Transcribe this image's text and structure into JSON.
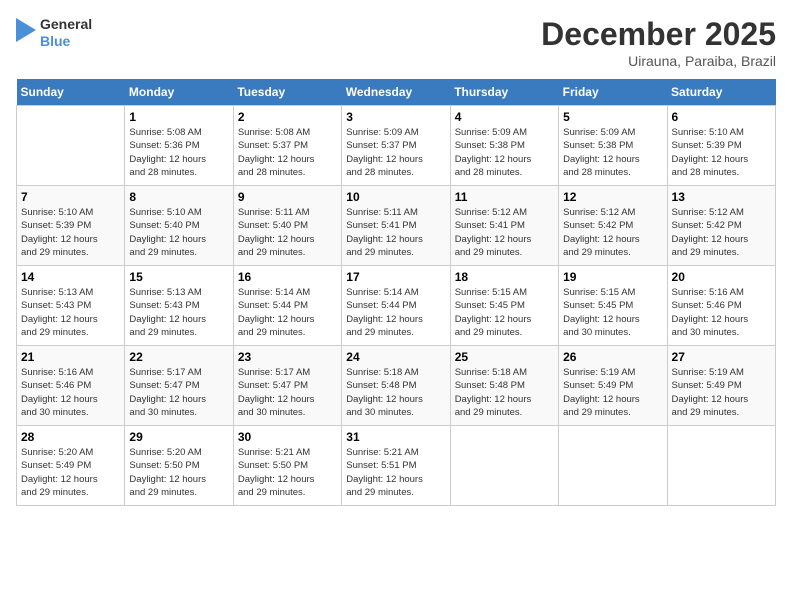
{
  "header": {
    "logo_line1": "General",
    "logo_line2": "Blue",
    "month": "December 2025",
    "location": "Uirauna, Paraiba, Brazil"
  },
  "days_of_week": [
    "Sunday",
    "Monday",
    "Tuesday",
    "Wednesday",
    "Thursday",
    "Friday",
    "Saturday"
  ],
  "weeks": [
    [
      {
        "day": "",
        "info": ""
      },
      {
        "day": "1",
        "info": "Sunrise: 5:08 AM\nSunset: 5:36 PM\nDaylight: 12 hours\nand 28 minutes."
      },
      {
        "day": "2",
        "info": "Sunrise: 5:08 AM\nSunset: 5:37 PM\nDaylight: 12 hours\nand 28 minutes."
      },
      {
        "day": "3",
        "info": "Sunrise: 5:09 AM\nSunset: 5:37 PM\nDaylight: 12 hours\nand 28 minutes."
      },
      {
        "day": "4",
        "info": "Sunrise: 5:09 AM\nSunset: 5:38 PM\nDaylight: 12 hours\nand 28 minutes."
      },
      {
        "day": "5",
        "info": "Sunrise: 5:09 AM\nSunset: 5:38 PM\nDaylight: 12 hours\nand 28 minutes."
      },
      {
        "day": "6",
        "info": "Sunrise: 5:10 AM\nSunset: 5:39 PM\nDaylight: 12 hours\nand 28 minutes."
      }
    ],
    [
      {
        "day": "7",
        "info": "Sunrise: 5:10 AM\nSunset: 5:39 PM\nDaylight: 12 hours\nand 29 minutes."
      },
      {
        "day": "8",
        "info": "Sunrise: 5:10 AM\nSunset: 5:40 PM\nDaylight: 12 hours\nand 29 minutes."
      },
      {
        "day": "9",
        "info": "Sunrise: 5:11 AM\nSunset: 5:40 PM\nDaylight: 12 hours\nand 29 minutes."
      },
      {
        "day": "10",
        "info": "Sunrise: 5:11 AM\nSunset: 5:41 PM\nDaylight: 12 hours\nand 29 minutes."
      },
      {
        "day": "11",
        "info": "Sunrise: 5:12 AM\nSunset: 5:41 PM\nDaylight: 12 hours\nand 29 minutes."
      },
      {
        "day": "12",
        "info": "Sunrise: 5:12 AM\nSunset: 5:42 PM\nDaylight: 12 hours\nand 29 minutes."
      },
      {
        "day": "13",
        "info": "Sunrise: 5:12 AM\nSunset: 5:42 PM\nDaylight: 12 hours\nand 29 minutes."
      }
    ],
    [
      {
        "day": "14",
        "info": "Sunrise: 5:13 AM\nSunset: 5:43 PM\nDaylight: 12 hours\nand 29 minutes."
      },
      {
        "day": "15",
        "info": "Sunrise: 5:13 AM\nSunset: 5:43 PM\nDaylight: 12 hours\nand 29 minutes."
      },
      {
        "day": "16",
        "info": "Sunrise: 5:14 AM\nSunset: 5:44 PM\nDaylight: 12 hours\nand 29 minutes."
      },
      {
        "day": "17",
        "info": "Sunrise: 5:14 AM\nSunset: 5:44 PM\nDaylight: 12 hours\nand 29 minutes."
      },
      {
        "day": "18",
        "info": "Sunrise: 5:15 AM\nSunset: 5:45 PM\nDaylight: 12 hours\nand 29 minutes."
      },
      {
        "day": "19",
        "info": "Sunrise: 5:15 AM\nSunset: 5:45 PM\nDaylight: 12 hours\nand 30 minutes."
      },
      {
        "day": "20",
        "info": "Sunrise: 5:16 AM\nSunset: 5:46 PM\nDaylight: 12 hours\nand 30 minutes."
      }
    ],
    [
      {
        "day": "21",
        "info": "Sunrise: 5:16 AM\nSunset: 5:46 PM\nDaylight: 12 hours\nand 30 minutes."
      },
      {
        "day": "22",
        "info": "Sunrise: 5:17 AM\nSunset: 5:47 PM\nDaylight: 12 hours\nand 30 minutes."
      },
      {
        "day": "23",
        "info": "Sunrise: 5:17 AM\nSunset: 5:47 PM\nDaylight: 12 hours\nand 30 minutes."
      },
      {
        "day": "24",
        "info": "Sunrise: 5:18 AM\nSunset: 5:48 PM\nDaylight: 12 hours\nand 30 minutes."
      },
      {
        "day": "25",
        "info": "Sunrise: 5:18 AM\nSunset: 5:48 PM\nDaylight: 12 hours\nand 29 minutes."
      },
      {
        "day": "26",
        "info": "Sunrise: 5:19 AM\nSunset: 5:49 PM\nDaylight: 12 hours\nand 29 minutes."
      },
      {
        "day": "27",
        "info": "Sunrise: 5:19 AM\nSunset: 5:49 PM\nDaylight: 12 hours\nand 29 minutes."
      }
    ],
    [
      {
        "day": "28",
        "info": "Sunrise: 5:20 AM\nSunset: 5:49 PM\nDaylight: 12 hours\nand 29 minutes."
      },
      {
        "day": "29",
        "info": "Sunrise: 5:20 AM\nSunset: 5:50 PM\nDaylight: 12 hours\nand 29 minutes."
      },
      {
        "day": "30",
        "info": "Sunrise: 5:21 AM\nSunset: 5:50 PM\nDaylight: 12 hours\nand 29 minutes."
      },
      {
        "day": "31",
        "info": "Sunrise: 5:21 AM\nSunset: 5:51 PM\nDaylight: 12 hours\nand 29 minutes."
      },
      {
        "day": "",
        "info": ""
      },
      {
        "day": "",
        "info": ""
      },
      {
        "day": "",
        "info": ""
      }
    ]
  ]
}
